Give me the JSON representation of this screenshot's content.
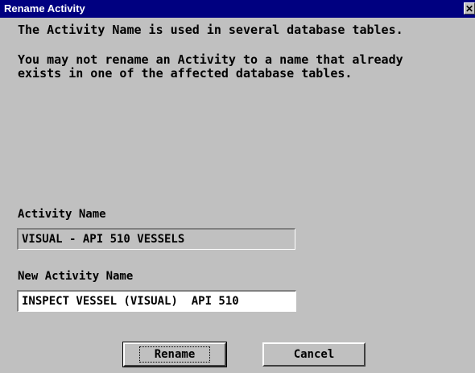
{
  "window": {
    "title": "Rename Activity",
    "close_glyph": "✕"
  },
  "message": {
    "line1": "The Activity Name is used in several database tables.",
    "line2": "You may not rename an Activity to a name that already",
    "line3": "exists in one of the affected database tables."
  },
  "activity_name": {
    "label": "Activity Name",
    "value": "VISUAL - API 510 VESSELS"
  },
  "new_activity_name": {
    "label": "New Activity Name",
    "value": "INSPECT VESSEL (VISUAL)  API 510"
  },
  "buttons": {
    "rename": "Rename",
    "cancel": "Cancel"
  },
  "colors": {
    "titlebar": "#000080",
    "face": "#c0c0c0"
  }
}
